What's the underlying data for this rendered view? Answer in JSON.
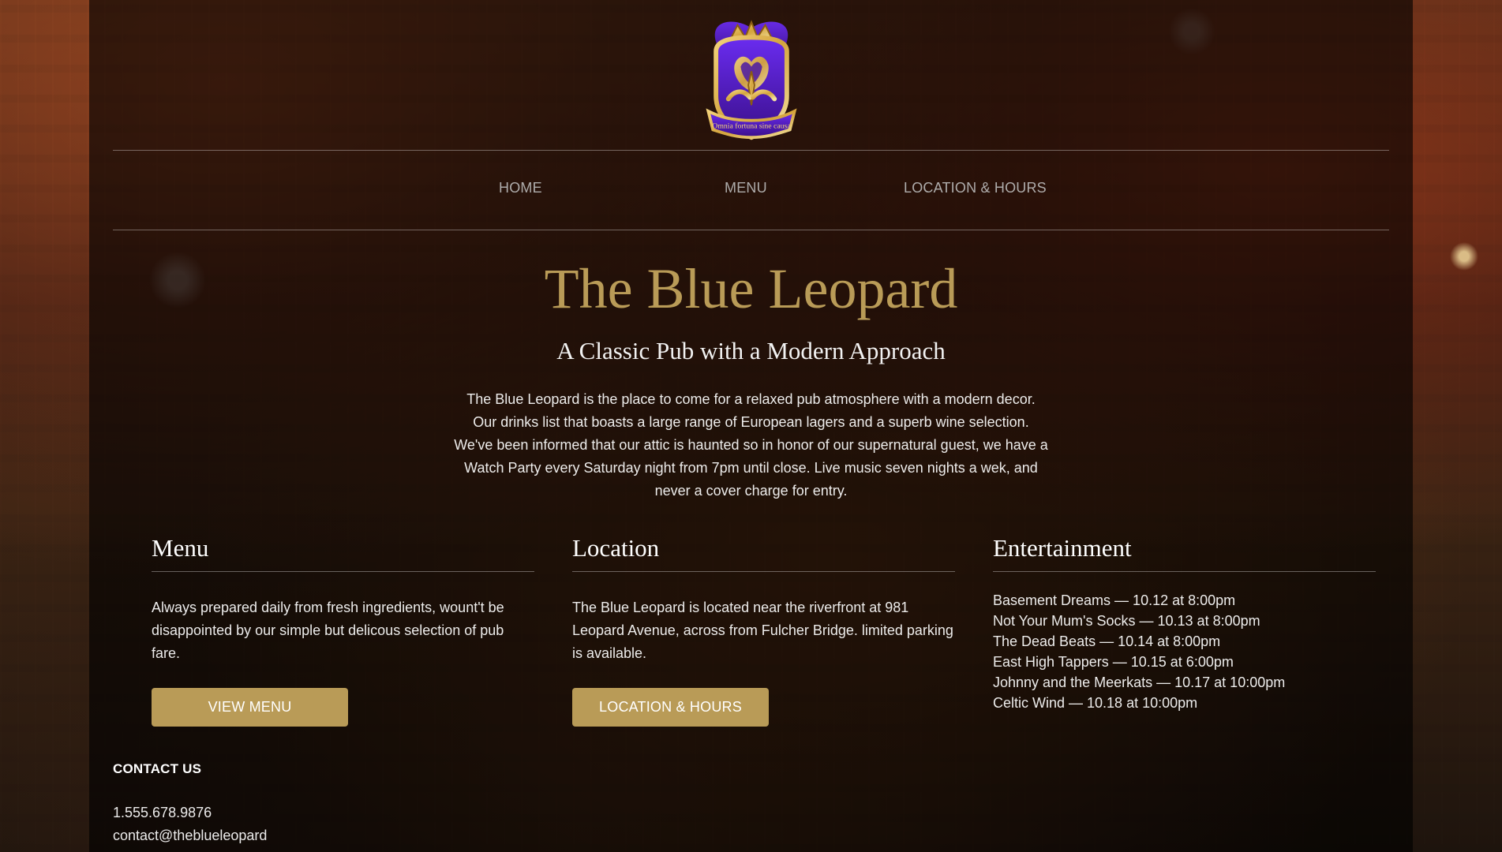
{
  "brand": {
    "name": "The Blue Leopard",
    "tagline": "A Classic Pub with a Modern Approach",
    "logo_motto": "Omnia fortuna sine causa"
  },
  "nav": {
    "items": [
      {
        "label": "HOME"
      },
      {
        "label": "MENU"
      },
      {
        "label": "LOCATION & HOURS"
      }
    ]
  },
  "intro": {
    "text": "The Blue Leopard is the place to come for a relaxed pub atmosphere with a modern decor. Our drinks list that boasts a large range of European lagers and a superb wine selection. We've been informed that our attic is haunted so in honor of our supernatural guest, we have a Watch Party every Saturday night from 7pm until close. Live music seven nights a wek, and never a cover charge for entry."
  },
  "columns": {
    "menu": {
      "title": "Menu",
      "text": "Always prepared daily from fresh ingredients, wount't be disappointed by our simple but delicous selection of pub fare.",
      "button_label": "VIEW MENU"
    },
    "location": {
      "title": "Location",
      "text": "The Blue Leopard is located near the riverfront at 981 Leopard Avenue, across from Fulcher Bridge. limited parking is available.",
      "button_label": "LOCATION & HOURS"
    },
    "entertainment": {
      "title": "Entertainment",
      "items": [
        "Basement Dreams — 10.12 at 8:00pm",
        "Not Your Mum's Socks — 10.13 at 8:00pm",
        "The Dead Beats — 10.14 at 8:00pm",
        "East High Tappers — 10.15 at 6:00pm",
        "Johnny and the Meerkats — 10.17 at 10:00pm",
        "Celtic Wind — 10.18 at 10:00pm"
      ]
    }
  },
  "contact": {
    "heading": "CONTACT US",
    "phone": "1.555.678.9876",
    "email": "contact@theblueleopard"
  },
  "colors": {
    "gold": "#b99b57",
    "purple": "#4b1aa6",
    "panel_overlay": "rgba(0,0,0,0.62)"
  },
  "icons": {
    "logo": "crest-logo-icon"
  }
}
